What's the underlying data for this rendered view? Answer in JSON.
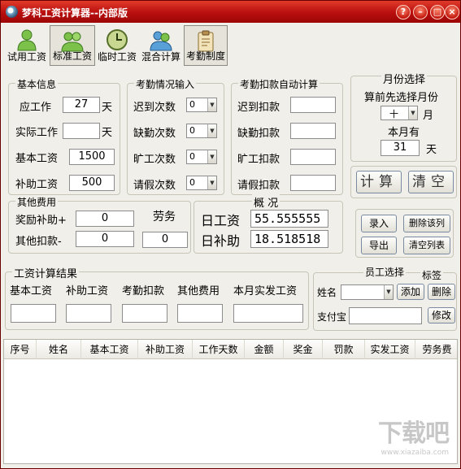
{
  "window": {
    "title": "梦科工资计算器--内部版",
    "buttons": {
      "help": "?",
      "minimize": "–",
      "maximize": "□",
      "close": "×"
    }
  },
  "toolbar": {
    "items": [
      {
        "label": "试用工资",
        "icon": "person-icon"
      },
      {
        "label": "标准工资",
        "icon": "people-icon",
        "active": true
      },
      {
        "label": "临时工资",
        "icon": "clock-icon"
      },
      {
        "label": "混合计算",
        "icon": "users-icon"
      },
      {
        "label": "考勤制度",
        "icon": "clipboard-icon"
      }
    ]
  },
  "basic_info": {
    "title": "基本信息",
    "attendance_label": "应工作",
    "attendance_value": "27",
    "attendance_unit": "天",
    "actual_label": "实际工作",
    "actual_value": "",
    "actual_unit": "天",
    "base_label": "基本工资",
    "base_value": "1500",
    "subsidy_label": "补助工资",
    "subsidy_value": "500"
  },
  "attendance_input": {
    "title": "考勤情况输入",
    "late_label": "迟到次数",
    "late_value": "0",
    "absent_label": "缺勤次数",
    "absent_value": "0",
    "truant_label": "旷工次数",
    "truant_value": "0",
    "leave_label": "请假次数",
    "leave_value": "0"
  },
  "deduction_auto": {
    "title": "考勤扣款自动计算",
    "late_label": "迟到扣款",
    "absent_label": "缺勤扣款",
    "truant_label": "旷工扣款",
    "leave_label": "请假扣款"
  },
  "month_select": {
    "title": "月份选择",
    "hint": "算前先选择月份",
    "month_value": "十",
    "month_unit": "月",
    "days_label": "本月有",
    "days_value": "31",
    "days_unit": "天"
  },
  "actions": {
    "calc": "计算",
    "clear": "清空"
  },
  "other_fees": {
    "title": "其他费用",
    "bonus_label": "奖励补助+",
    "bonus_value": "0",
    "deduct_label": "其他扣款-",
    "deduct_value": "0",
    "labor_label": "劳务",
    "labor_value": "0"
  },
  "overview": {
    "title": "概 况",
    "daily_wage_label": "日工资",
    "daily_wage_value": "55.555555",
    "daily_subsidy_label": "日补助",
    "daily_subsidy_value": "18.518518"
  },
  "record_buttons": {
    "enter": "录入",
    "delete_col": "删除该列",
    "export": "导出",
    "clear_list": "清空列表"
  },
  "result": {
    "title": "工资计算结果",
    "base": "基本工资",
    "subsidy": "补助工资",
    "deduction": "考勤扣款",
    "other": "其他费用",
    "actual": "本月实发工资"
  },
  "employee": {
    "title": "员工选择",
    "tag_title": "标签",
    "name_label": "姓名",
    "add_button": "添加",
    "delete_button": "删除",
    "alipay_label": "支付宝",
    "modify_button": "修改"
  },
  "table": {
    "columns": [
      "序号",
      "姓名",
      "基本工资",
      "补助工资",
      "工作天数",
      "金额",
      "奖金",
      "罚款",
      "实发工资",
      "劳务费"
    ]
  },
  "watermark": {
    "text": "下载吧",
    "sub": "www.xiazaiba.com"
  }
}
